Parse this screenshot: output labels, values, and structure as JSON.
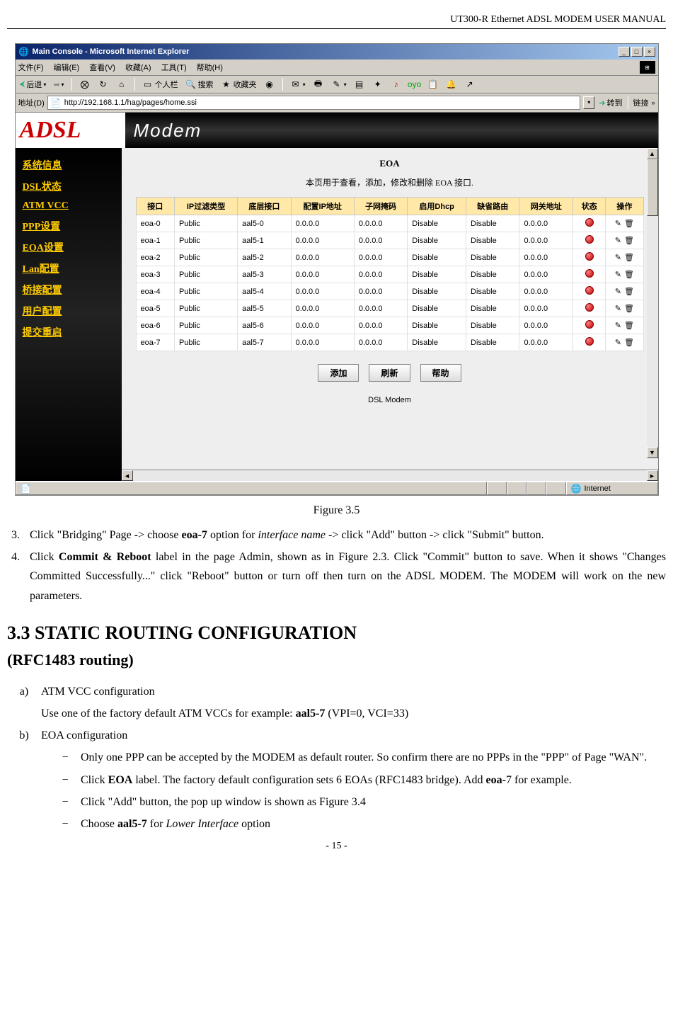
{
  "header": "UT300-R Ethernet ADSL MODEM USER MANUAL",
  "ie": {
    "title": "Main Console - Microsoft Internet Explorer",
    "menus": [
      "文件(F)",
      "编辑(E)",
      "查看(V)",
      "收藏(A)",
      "工具(T)",
      "帮助(H)"
    ],
    "toolbar": {
      "back": "后退",
      "personal": "个人栏",
      "search": "搜索",
      "fav": "收藏夹"
    },
    "addr_label": "地址(D)",
    "url": "http://192.168.1.1/hag/pages/home.ssi",
    "go": "转到",
    "links": "链接"
  },
  "adsl_logo": "ADSL",
  "modem_banner": "Modem",
  "sidebar": [
    "系统信息",
    "DSL状态",
    "ATM VCC",
    "PPP设置",
    "EOA设置",
    "Lan配置",
    "桥接配置",
    "用户配置",
    "提交重启"
  ],
  "eoa": {
    "title": "EOA",
    "desc": "本页用于查看，添加，修改和删除 EOA 接口.",
    "headers": [
      "接口",
      "IP过滤类型",
      "底层接口",
      "配置IP地址",
      "子网掩码",
      "启用Dhcp",
      "缺省路由",
      "网关地址",
      "状态",
      "操作"
    ],
    "rows": [
      {
        "iface": "eoa-0",
        "filter": "Public",
        "lower": "aal5-0",
        "ip": "0.0.0.0",
        "mask": "0.0.0.0",
        "dhcp": "Disable",
        "route": "Disable",
        "gw": "0.0.0.0"
      },
      {
        "iface": "eoa-1",
        "filter": "Public",
        "lower": "aal5-1",
        "ip": "0.0.0.0",
        "mask": "0.0.0.0",
        "dhcp": "Disable",
        "route": "Disable",
        "gw": "0.0.0.0"
      },
      {
        "iface": "eoa-2",
        "filter": "Public",
        "lower": "aal5-2",
        "ip": "0.0.0.0",
        "mask": "0.0.0.0",
        "dhcp": "Disable",
        "route": "Disable",
        "gw": "0.0.0.0"
      },
      {
        "iface": "eoa-3",
        "filter": "Public",
        "lower": "aal5-3",
        "ip": "0.0.0.0",
        "mask": "0.0.0.0",
        "dhcp": "Disable",
        "route": "Disable",
        "gw": "0.0.0.0"
      },
      {
        "iface": "eoa-4",
        "filter": "Public",
        "lower": "aal5-4",
        "ip": "0.0.0.0",
        "mask": "0.0.0.0",
        "dhcp": "Disable",
        "route": "Disable",
        "gw": "0.0.0.0"
      },
      {
        "iface": "eoa-5",
        "filter": "Public",
        "lower": "aal5-5",
        "ip": "0.0.0.0",
        "mask": "0.0.0.0",
        "dhcp": "Disable",
        "route": "Disable",
        "gw": "0.0.0.0"
      },
      {
        "iface": "eoa-6",
        "filter": "Public",
        "lower": "aal5-6",
        "ip": "0.0.0.0",
        "mask": "0.0.0.0",
        "dhcp": "Disable",
        "route": "Disable",
        "gw": "0.0.0.0"
      },
      {
        "iface": "eoa-7",
        "filter": "Public",
        "lower": "aal5-7",
        "ip": "0.0.0.0",
        "mask": "0.0.0.0",
        "dhcp": "Disable",
        "route": "Disable",
        "gw": "0.0.0.0"
      }
    ],
    "btn_add": "添加",
    "btn_refresh": "刷新",
    "btn_help": "帮助",
    "footer": "DSL Modem"
  },
  "status_internet": "Internet",
  "caption": "Figure 3.5",
  "step3_num": "3.",
  "step3_a": "Click \"Bridging\" Page -> choose ",
  "step3_b": "eoa-7",
  "step3_c": " option for ",
  "step3_d": "interface name",
  "step3_e": " -> click \"Add\" button -> click \"Submit\" button.",
  "step4_num": "4.",
  "step4_a": "Click ",
  "step4_b": "Commit & Reboot",
  "step4_c": " label in the page Admin, shown as in Figure 2.3. Click \"Commit\" button to save. When it shows \"Changes Committed Successfully...\" click \"Reboot\" button or turn off then turn on the ADSL MODEM.   The MODEM will work on the new parameters.",
  "section_a": "3.3 STATIC ROUTING CONFIGURATION",
  "section_b": "(RFC1483 routing)",
  "a_num": "a)",
  "a_txt": "ATM VCC configuration",
  "a_sub_a": "Use one of the factory default ATM VCCs for example: ",
  "a_sub_b": "aal5-7",
  "a_sub_c": " (VPI=0, VCI=33)",
  "b_num": "b)",
  "b_txt": "EOA configuration",
  "dash": "−",
  "b1": "Only one PPP can be accepted by the MODEM as default router.   So confirm there are no PPPs in the \"PPP\" of Page \"WAN\".",
  "b2_a": "Click ",
  "b2_b": "EOA",
  "b2_c": " label. The factory default configuration sets 6 EOAs (RFC1483 bridge). Add ",
  "b2_d": "eoa-",
  "b2_e": "7 for example.",
  "b3": "Click \"Add\" button, the pop up window is shown as Figure 3.4",
  "b4_a": "Choose ",
  "b4_b": "aal5-7",
  "b4_c": " for ",
  "b4_d": "Lower Interface",
  "b4_e": " option",
  "page_num": "- 15 -"
}
